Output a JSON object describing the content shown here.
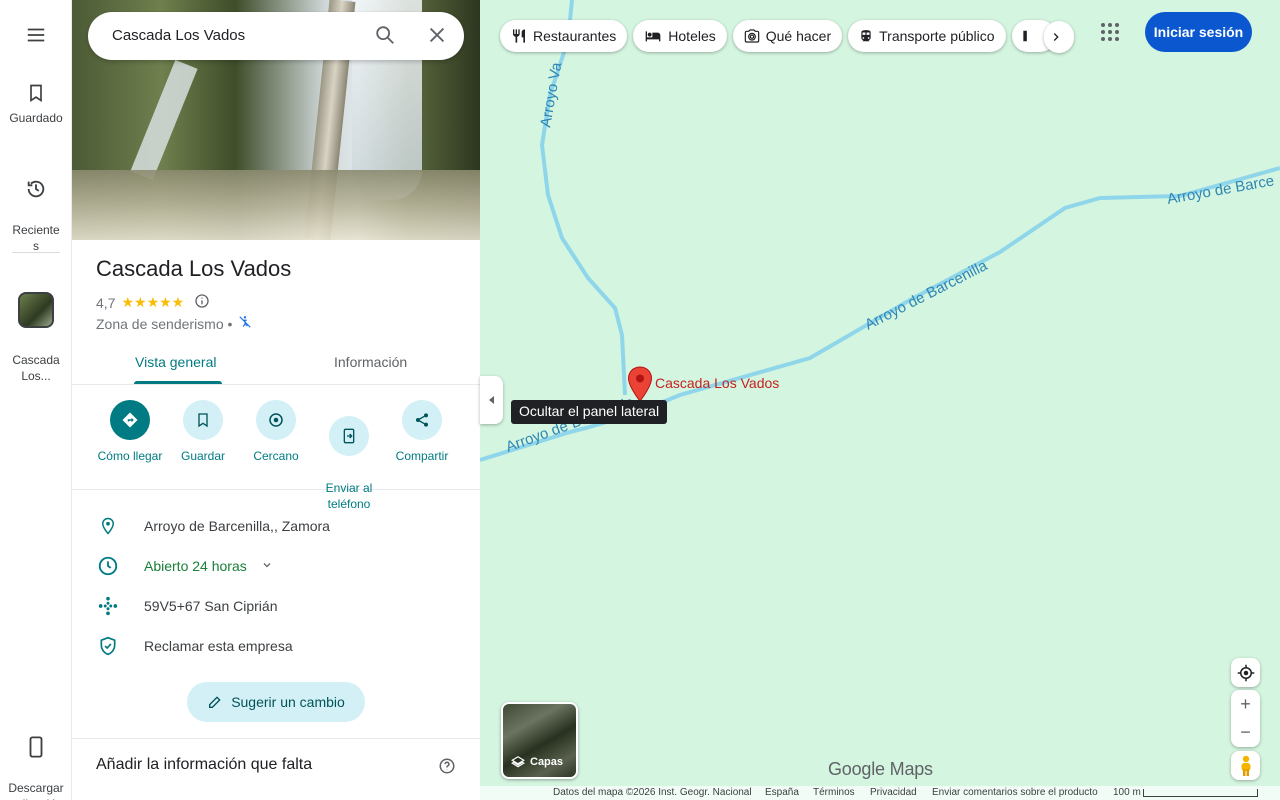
{
  "rail": {
    "saved_label": "Guardado",
    "recent_label": "Reciente\ns",
    "place_label": "Cascada\nLos...",
    "download_label": "Descargar\naplicación"
  },
  "search": {
    "value": "Cascada Los Vados"
  },
  "place": {
    "name": "Cascada Los Vados",
    "rating": "4,7",
    "stars": "★★★★★",
    "category": "Zona de senderismo •"
  },
  "tabs": [
    {
      "label": "Vista general"
    },
    {
      "label": "Información"
    }
  ],
  "actions": [
    {
      "label": "Cómo llegar"
    },
    {
      "label": "Guardar"
    },
    {
      "label": "Cercano"
    },
    {
      "label": "Enviar al\nteléfono"
    },
    {
      "label": "Compartir"
    }
  ],
  "info": {
    "address": "Arroyo de Barcenilla,, Zamora",
    "hours": "Abierto 24 horas",
    "plus_code": "59V5+67 San Ciprián",
    "claim": "Reclamar esta empresa"
  },
  "suggest_label": "Sugerir un cambio",
  "missing_title": "Añadir la información que falta",
  "collapse_tooltip": "Ocultar el panel lateral",
  "chips": [
    {
      "label": "Restaurantes",
      "icon": "fork-knife-icon"
    },
    {
      "label": "Hoteles",
      "icon": "bed-icon"
    },
    {
      "label": "Qué hacer",
      "icon": "camera-icon"
    },
    {
      "label": "Transporte público",
      "icon": "train-icon"
    }
  ],
  "signin_label": "Iniciar sesión",
  "layers_label": "Capas",
  "logo": "Google Maps",
  "map": {
    "pin_label": "Cascada Los Vados",
    "rivers": {
      "label_1": "Arroyo de Barcenilla",
      "label_2": "Arroyo de Barce",
      "label_3": "Arroyo Va",
      "label_4": "Arroyo de Barcenilla"
    }
  },
  "footer": {
    "data": "Datos del mapa ©2026 Inst. Geogr. Nacional",
    "country": "España",
    "terms": "Términos",
    "privacy": "Privacidad",
    "feedback": "Enviar comentarios sobre el producto",
    "scale": "100 m"
  },
  "colors": {
    "accent": "#007b83",
    "brand_blue": "#0b57d0",
    "map_bg": "#d4f5e0",
    "river": "#8fd6ea",
    "pin_red": "#ea4335"
  }
}
